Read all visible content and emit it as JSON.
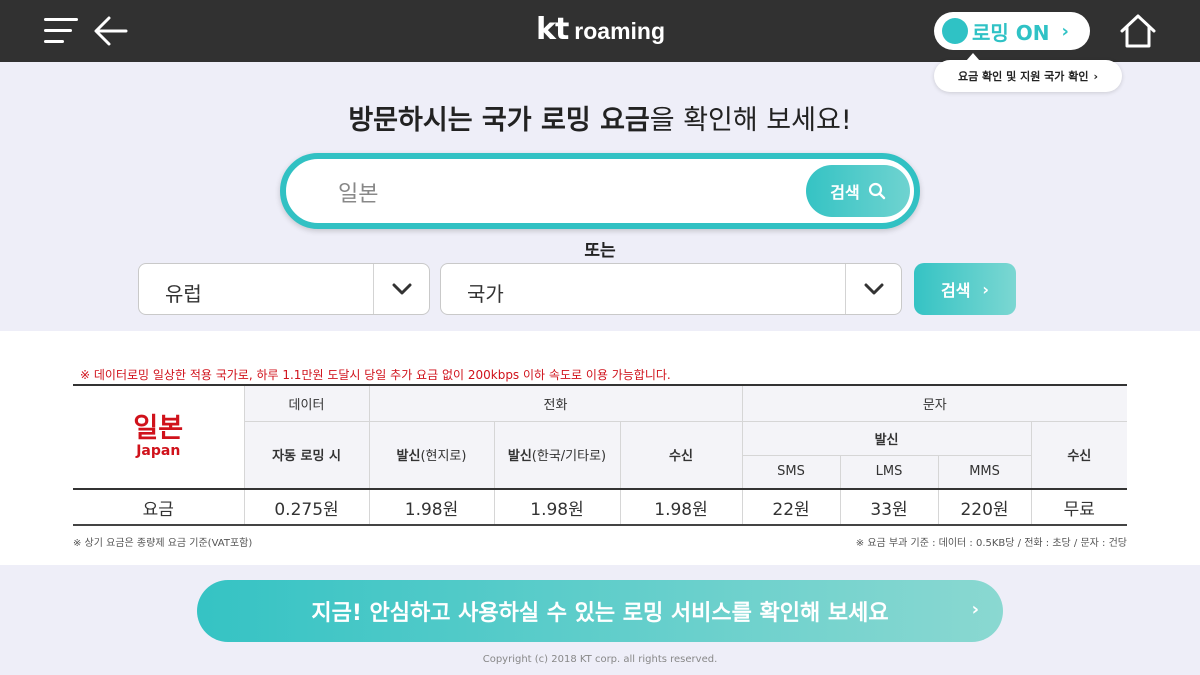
{
  "header": {
    "logo_kt": "kt",
    "logo_text": "roaming",
    "roaming_toggle": {
      "label": "로밍 ON",
      "chevron": "›"
    },
    "tooltip": {
      "label": "요금 확인 및 지원 국가 확인",
      "chevron": "›"
    }
  },
  "search": {
    "headline_bold": "방문하시는 국가 로밍 요금",
    "headline_rest": "을 확인해 보세요!",
    "input_value": "일본",
    "button_label": "검색",
    "or_label": "또는",
    "region_select": "유럽",
    "country_select": "국가",
    "select_button_label": "검색",
    "select_button_chevron": "›"
  },
  "rates": {
    "notice": "※ 데이터로밍 일상한 적용 국가로, 하루 1.1만원 도달시 당일 추가 요금 없이 200kbps 이하 속도로 이용 가능합니다.",
    "country_kr": "일본",
    "country_en": "Japan",
    "headers": {
      "data": "데이터",
      "call": "전화",
      "sms_group": "문자",
      "auto_roaming": "자동 로밍 시",
      "outgoing_local_bold": "발신",
      "outgoing_local_rest": "(현지로)",
      "outgoing_intl_bold": "발신",
      "outgoing_intl_rest": "(한국/기타로)",
      "incoming": "수신",
      "msg_outgoing": "발신",
      "msg_incoming": "수신",
      "sms": "SMS",
      "lms": "LMS",
      "mms": "MMS"
    },
    "row": {
      "label": "요금",
      "data": "0.275원",
      "call_local": "1.98원",
      "call_intl": "1.98원",
      "call_in": "1.98원",
      "sms": "22원",
      "lms": "33원",
      "mms": "220원",
      "msg_in": "무료"
    },
    "footnote_left": "※ 상기 요금은 종량제 요금 기준(VAT포함)",
    "footnote_right": "※ 요금 부과 기준 : 데이터 : 0.5KB당 / 전화 : 초당 / 문자 : 건당"
  },
  "cta": {
    "label": "지금! 안심하고 사용하실 수 있는 로밍 서비스를 확인해 보세요",
    "chevron": "›"
  },
  "footer": {
    "copyright": "Copyright (c) 2018 KT corp. all rights reserved."
  },
  "colors": {
    "header_bg": "#313131",
    "accent": "#31c1c3",
    "alert": "#d0121b",
    "page_bg": "#eeeef8"
  },
  "icons": {
    "menu": "hamburger-menu-icon",
    "back": "arrow-left-icon",
    "home": "home-icon",
    "search": "search-icon",
    "dropdown": "chevron-down-icon"
  }
}
